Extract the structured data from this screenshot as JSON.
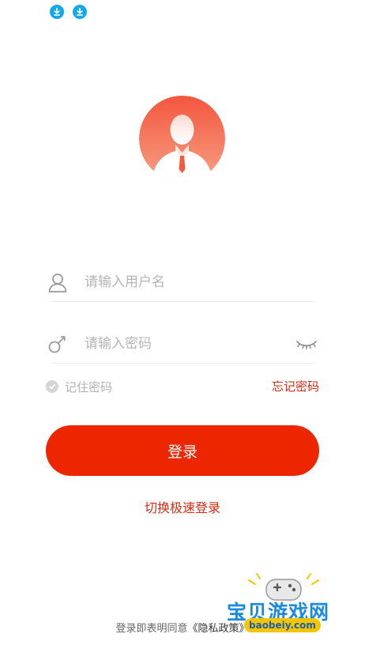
{
  "status_bar": {
    "icons": [
      "download-icon",
      "download-icon"
    ]
  },
  "avatar": {
    "icon": "user-avatar-icon",
    "colors": {
      "top": "#f4553e",
      "bottom": "#f6a183"
    }
  },
  "username": {
    "icon": "user-icon",
    "placeholder": "请输入用户名",
    "value": ""
  },
  "password": {
    "icon": "key-icon",
    "placeholder": "请输入密码",
    "value": "",
    "toggle_icon": "eye-closed-icon"
  },
  "remember": {
    "label": "记住密码",
    "checked": false
  },
  "forgot_password": "忘记密码",
  "login_button": "登录",
  "switch_mode": "切换极速登录",
  "agreement": {
    "prefix": "登录即表明同意",
    "policy": "《隐私政策》"
  },
  "watermark": {
    "title": "宝贝游戏网",
    "url": "baobeiy.com"
  },
  "colors": {
    "accent": "#ee2600",
    "link": "#d62b14",
    "status_icon": "#14a9e6"
  }
}
